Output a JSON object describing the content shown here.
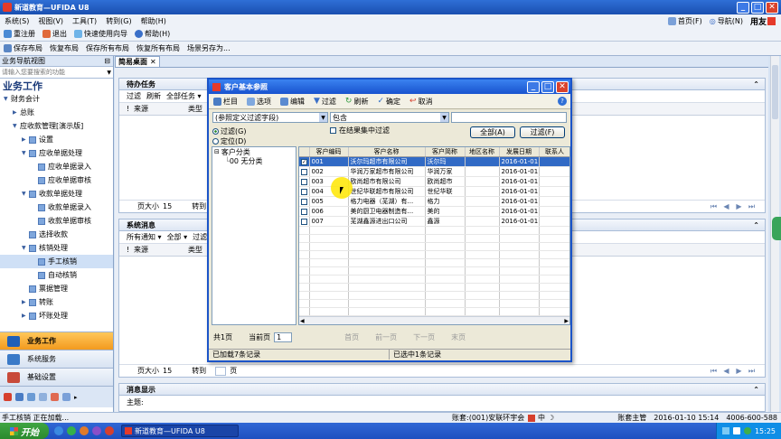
{
  "window": {
    "title": "新道教育—UFIDA U8",
    "brand": "用友"
  },
  "menu": [
    "系统(S)",
    "视图(V)",
    "工具(T)",
    "转到(G)",
    "帮助(H)"
  ],
  "top_right": {
    "home": "首页(F)",
    "nav": "导航(N)"
  },
  "toolbar": [
    "重注册",
    "退出",
    "快速使用向导",
    "帮助(H)"
  ],
  "toolbar2": [
    "保存布局",
    "恢复布局",
    "保存所有布局",
    "恢复所有布局",
    "场景另存为..."
  ],
  "sidebar": {
    "header": "业务导航视图",
    "search_placeholder": "请输入您要搜索的功能",
    "section": "业务工作",
    "items": [
      {
        "label": "财务会计",
        "level": 0,
        "arrow": "▼"
      },
      {
        "label": "总账",
        "level": 1,
        "arrow": "▶"
      },
      {
        "label": "应收款管理[演示版]",
        "level": 1,
        "arrow": "▼"
      },
      {
        "label": "设置",
        "level": 2,
        "arrow": "▶"
      },
      {
        "label": "应收单据处理",
        "level": 2,
        "arrow": "▼"
      },
      {
        "label": "应收单据录入",
        "level": 3,
        "arrow": ""
      },
      {
        "label": "应收单据审核",
        "level": 3,
        "arrow": ""
      },
      {
        "label": "收款单据处理",
        "level": 2,
        "arrow": "▼"
      },
      {
        "label": "收款单据录入",
        "level": 3,
        "arrow": ""
      },
      {
        "label": "收款单据审核",
        "level": 3,
        "arrow": ""
      },
      {
        "label": "选择收款",
        "level": 2,
        "arrow": ""
      },
      {
        "label": "核销处理",
        "level": 2,
        "arrow": "▼"
      },
      {
        "label": "手工核销",
        "level": 3,
        "arrow": ""
      },
      {
        "label": "自动核销",
        "level": 3,
        "arrow": ""
      },
      {
        "label": "票据管理",
        "level": 2,
        "arrow": ""
      },
      {
        "label": "转账",
        "level": 2,
        "arrow": "▶"
      },
      {
        "label": "坏账处理",
        "level": 2,
        "arrow": "▶"
      }
    ],
    "nav_buttons": [
      "业务工作",
      "系统服务",
      "基础设置"
    ]
  },
  "main": {
    "tab": "简易桌面",
    "todo": {
      "title": "待办任务",
      "tools": [
        "过滤",
        "刷新",
        "全部任务"
      ],
      "cols": [
        "!",
        "来源",
        "类型"
      ],
      "page_size_label": "页大小",
      "page_size": "15",
      "goto": "转到"
    },
    "sysmsg": {
      "title": "系统消息",
      "tools": [
        "所有通知",
        "全部",
        "过滤"
      ],
      "cols": [
        "!",
        "来源",
        "类型"
      ],
      "page_size_label": "页大小",
      "page_size": "15",
      "goto": "转到",
      "page": "页"
    },
    "msgshow": {
      "title": "消息显示",
      "subject": "主题:"
    }
  },
  "dialog": {
    "title": "客户基本参照",
    "tools": [
      "栏目",
      "选项",
      "编辑",
      "过滤",
      "刷新",
      "确定",
      "取消"
    ],
    "filter_field": "(参照定义过滤字段)",
    "filter_op": "包含",
    "filter_in_result": "在结果集中过滤",
    "radio_filter": "过滤(G)",
    "radio_locate": "定位(D)",
    "btn_all": "全部(A)",
    "btn_filter": "过滤(F)",
    "tree": {
      "root": "客户分类",
      "child": "00 无分类"
    },
    "columns": [
      "客户编码",
      "客户名称",
      "客户简称",
      "地区名称",
      "发展日期",
      "联系人"
    ],
    "rows": [
      {
        "code": "001",
        "name": "沃尔玛超市有限公司",
        "short": "沃尔玛",
        "region": "",
        "date": "2016-01-01",
        "contact": "",
        "checked": true
      },
      {
        "code": "002",
        "name": "华润万家超市有限公司",
        "short": "华润万家",
        "region": "",
        "date": "2016-01-01",
        "contact": "",
        "checked": false
      },
      {
        "code": "003",
        "name": "欧尚超市有限公司",
        "short": "欧尚超市",
        "region": "",
        "date": "2016-01-01",
        "contact": "",
        "checked": false
      },
      {
        "code": "004",
        "name": "世纪华联超市有限公司",
        "short": "世纪华联",
        "region": "",
        "date": "2016-01-01",
        "contact": "",
        "checked": false
      },
      {
        "code": "005",
        "name": "格力电器（芜湖）有...",
        "short": "格力",
        "region": "",
        "date": "2016-01-01",
        "contact": "",
        "checked": false
      },
      {
        "code": "006",
        "name": "美的厨卫电器制造有...",
        "short": "美的",
        "region": "",
        "date": "2016-01-01",
        "contact": "",
        "checked": false
      },
      {
        "code": "007",
        "name": "芜湖鑫源进出口公司",
        "short": "鑫源",
        "region": "",
        "date": "2016-01-01",
        "contact": "",
        "checked": false
      }
    ],
    "total_pages": "共1页",
    "current_page_label": "当前页",
    "current_page": "1",
    "pager": [
      "首页",
      "前一页",
      "下一页",
      "末页"
    ],
    "status_loaded": "已加载7条记录",
    "status_selected": "已选中1条记录"
  },
  "status": {
    "left": "手工核销 正在加载...",
    "user": "账套:(001)安联环宇会",
    "ime": "中",
    "operator": "账套主管",
    "datetime": "2016-01-10 15:14",
    "phone": "4006-600-588"
  },
  "taskbar": {
    "start": "开始",
    "task": "新道教育—UFIDA U8",
    "clock": "15:25"
  }
}
